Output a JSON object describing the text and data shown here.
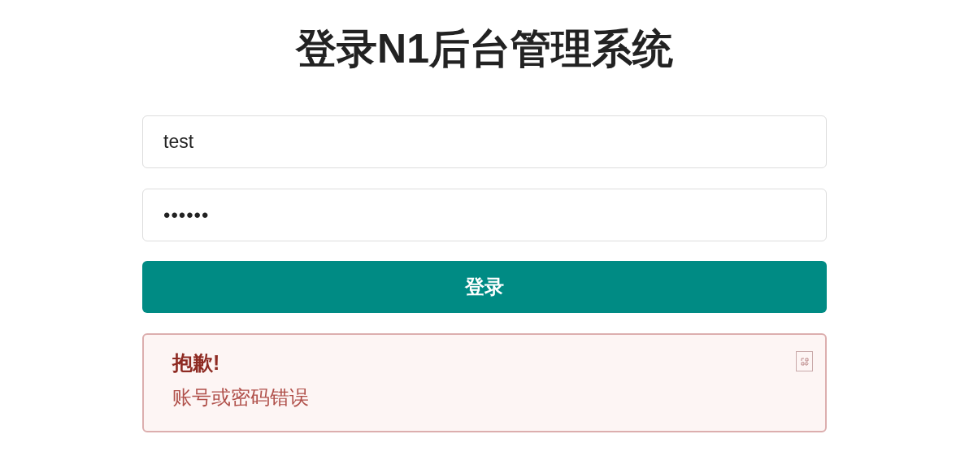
{
  "title": "登录N1后台管理系统",
  "username": {
    "value": "test"
  },
  "password": {
    "value": "••••••"
  },
  "submit": {
    "label": "登录"
  },
  "alert": {
    "heading": "抱歉!",
    "message": "账号或密码错误"
  }
}
